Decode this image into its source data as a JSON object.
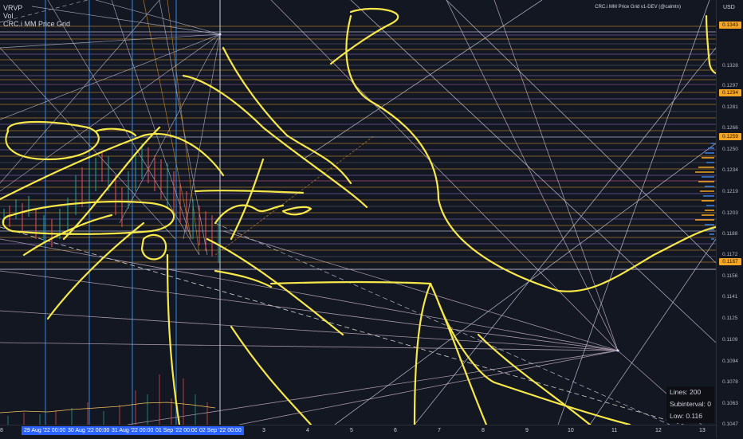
{
  "legend": {
    "vrvp": "VRVP",
    "vol": "Vol",
    "price_grid": "CRC.i MM Price Grid"
  },
  "indicator_title": "CRC.i MM Price Grid v1-DEV (@calmtn)",
  "price_axis": {
    "currency": "USD",
    "ticks": [
      "0.1328",
      "0.1297",
      "0.1281",
      "0.1266",
      "0.1250",
      "0.1234",
      "0.1219",
      "0.1203",
      "0.1188",
      "0.1172",
      "0.1156",
      "0.1141",
      "0.1125",
      "0.1109",
      "0.1094",
      "0.1078",
      "0.1063",
      "0.1047"
    ],
    "tags": [
      "0.1343",
      "0.1294",
      "0.1259",
      "0.1167"
    ]
  },
  "time_axis": {
    "edge_label": "8",
    "ticks": [
      "3",
      "4",
      "5",
      "6",
      "7",
      "8",
      "9",
      "10",
      "11",
      "12",
      "13"
    ],
    "tags": [
      "29 Aug '22  00:00",
      "30 Aug '22  00:00",
      "31 Aug '22  00:00",
      "01 Sep '22  00:00",
      "02 Sep '22  00:00"
    ]
  },
  "stats": {
    "lines": "Lines: 200",
    "subinterval": "Subinterval: 0",
    "low": "Low: 0.116"
  },
  "colors": {
    "background": "#131722",
    "drawing": "#f7e84a",
    "accent_tag": "#f5a623",
    "time_tag": "#2962ff"
  }
}
